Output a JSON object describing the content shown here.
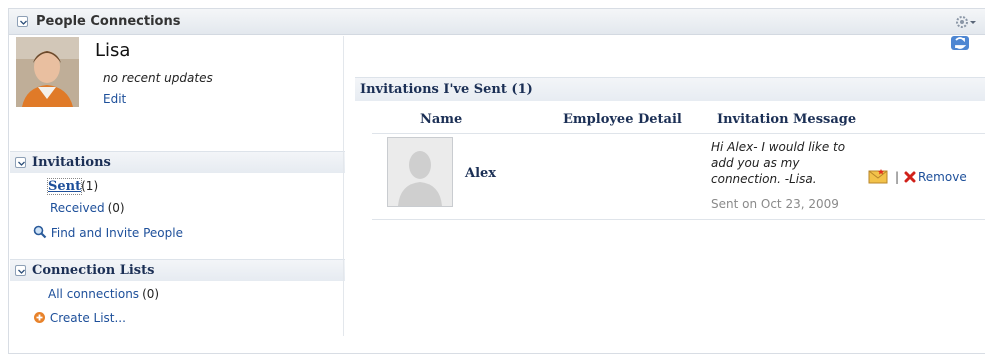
{
  "panel": {
    "title": "People Connections"
  },
  "profile": {
    "name": "Lisa",
    "status": "no recent updates",
    "edit_label": "Edit"
  },
  "invitations": {
    "title": "Invitations",
    "sent_label": "Sent",
    "sent_count": "(1)",
    "received_label": "Received",
    "received_count": "(0)",
    "find_label": "Find and Invite People"
  },
  "connection_lists": {
    "title": "Connection Lists",
    "all_label": "All connections",
    "all_count": "(0)",
    "create_label": "Create List..."
  },
  "sent_table": {
    "title": "Invitations I've Sent (1)",
    "columns": {
      "name": "Name",
      "detail": "Employee Detail",
      "message": "Invitation Message"
    },
    "rows": [
      {
        "name": "Alex",
        "message_lines": [
          "Hi Alex- I would like to",
          "add you as my",
          "connection. -Lisa."
        ],
        "sent_on": "Sent on Oct 23, 2009",
        "separator": "|",
        "remove_label": "Remove"
      }
    ]
  },
  "icons": {
    "panel_toggle": "chevron-down-icon",
    "gear": "gear-icon",
    "refresh": "refresh-icon",
    "search": "search-icon",
    "add": "add-icon",
    "accept": "accept-envelope-icon",
    "remove": "remove-icon"
  },
  "colors": {
    "link": "#1d4f9a",
    "heading": "#1b2f55",
    "header_bg": "#e6ebf1"
  }
}
